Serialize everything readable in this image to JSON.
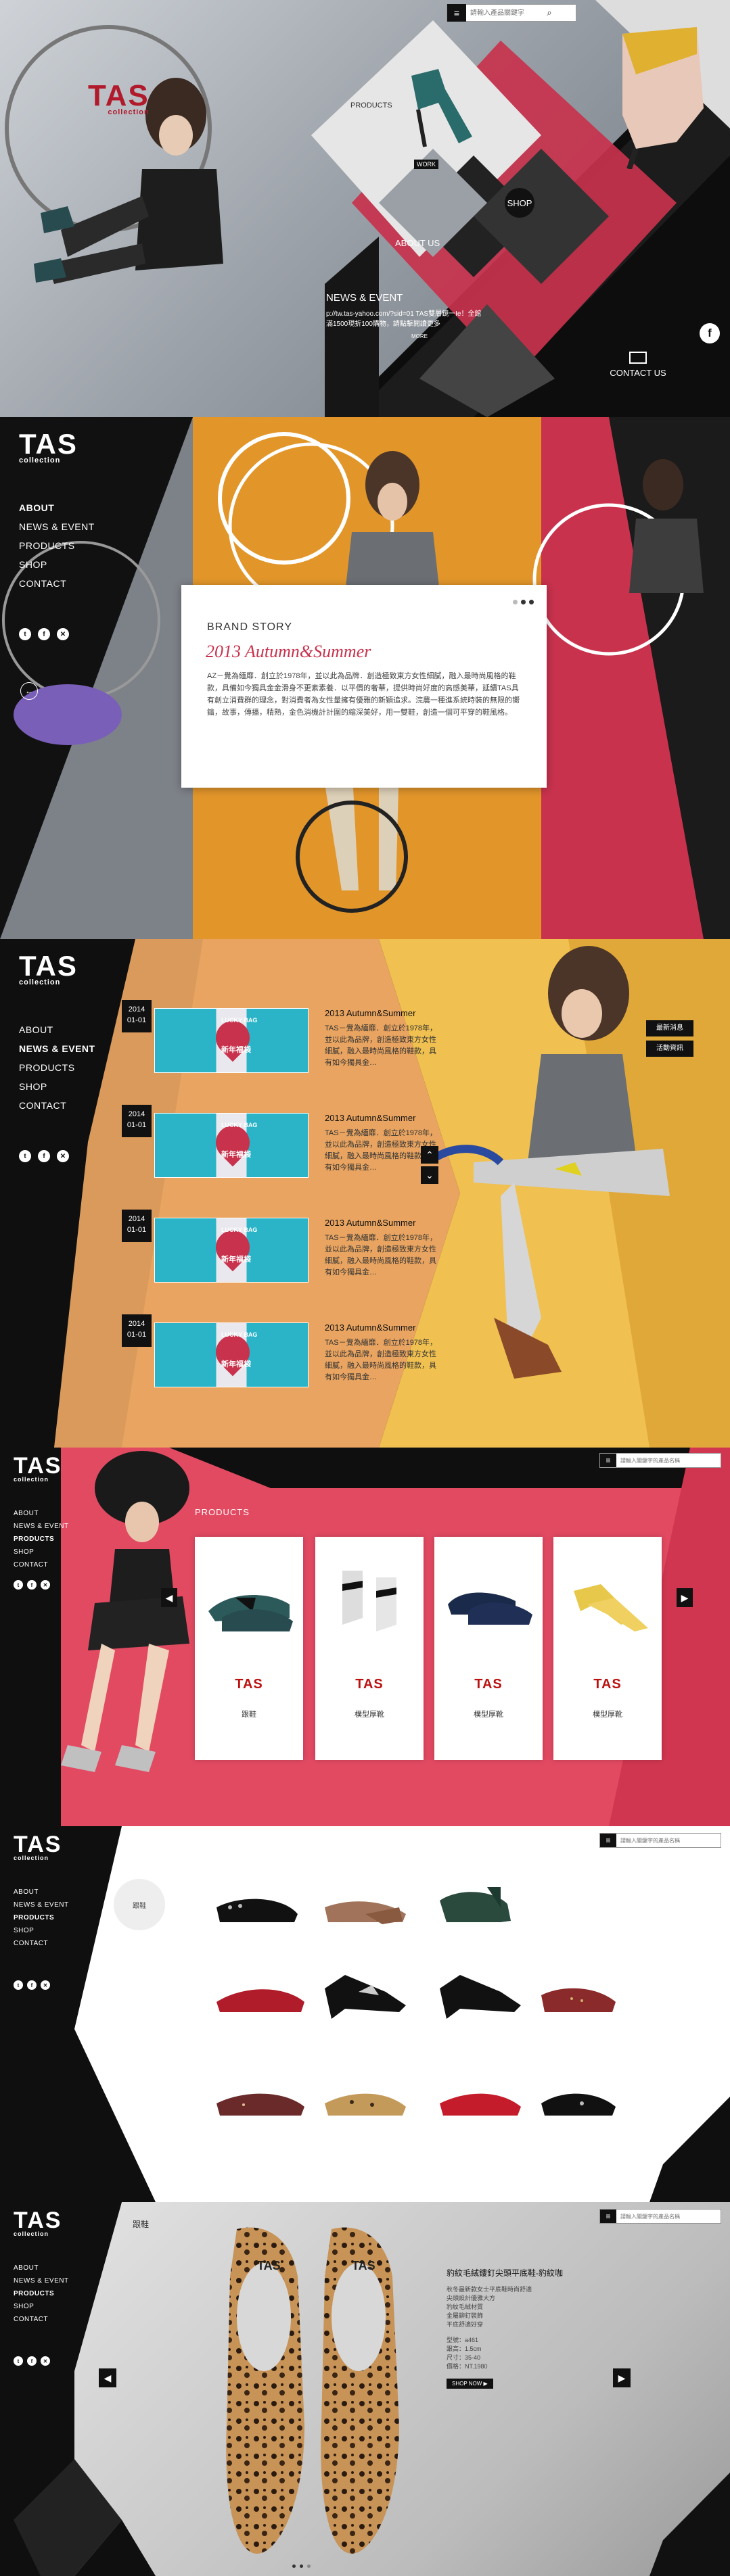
{
  "hero": {
    "search_placeholder": "請輸入產品關鍵字",
    "logo": "TAS",
    "logo_sub": "collection",
    "products_label": "PRODUCTS",
    "work_label": "WORK",
    "shop_label": "SHOP",
    "about_label": "ABOUT US",
    "news_title": "NEWS & EVENT",
    "news_text": "p://tw.tas-yahoo.com/?sid=01 TAS雙層鏡一Ie！全館滿1500現折100購物，請點擊閱讀更多",
    "news_more": "MORE",
    "contact_label": "CONTACT US"
  },
  "nav": {
    "about": "ABOUT",
    "news": "NEWS & EVENT",
    "products": "PRODUCTS",
    "shop": "SHOP",
    "contact": "CONTACT"
  },
  "brand": {
    "title": "BRAND STORY",
    "script": "2013 Autumn&Summer",
    "body": "AZ－覺為緬靡．創立於1978年，並以此為品牌．創造極致東方女性細膩，融入最時尚風格的鞋款，具備如今獨具金金滑身不更紊素養．以平價的奢華，提供時尚好度的高感美華，延續TAS具有創立消費群的理念，對消費者為女性量擁有優雅的新穎追求。浣農一種進系統時裝的無限的嚮鑰，故事，傳播，精熟，金色消機計計圍的縮深美好，用一雙鞋，創造一個可平穿的鞋風格。"
  },
  "news_list": {
    "items": [
      {
        "date1": "2014",
        "date2": "01-01",
        "title": "2013 Autumn&Summer",
        "text": "TAS－覺為緬靡．創立於1978年，並以此為品牌，創造極致東方女性細膩，融入最時尚風格的鞋款，具有如今獨具金…"
      },
      {
        "date1": "2014",
        "date2": "01-01",
        "title": "2013 Autumn&Summer",
        "text": "TAS－覺為緬靡．創立於1978年，並以此為品牌，創造極致東方女性細膩，融入最時尚風格的鞋款，具有如今獨具金…"
      },
      {
        "date1": "2014",
        "date2": "01-01",
        "title": "2013 Autumn&Summer",
        "text": "TAS－覺為緬靡．創立於1978年，並以此為品牌，創造極致東方女性細膩，融入最時尚風格的鞋款，具有如今獨具金…"
      },
      {
        "date1": "2014",
        "date2": "01-01",
        "title": "2013 Autumn&Summer",
        "text": "TAS－覺為緬靡．創立於1978年，並以此為品牌，創造極致東方女性細膩，融入最時尚風格的鞋款，具有如今獨具金…"
      }
    ],
    "thumb_label": "LUCKY BAG",
    "thumb_sub": "新年福袋",
    "tab1": "最新消息",
    "tab2": "活動資訊"
  },
  "products": {
    "title": "PRODUCTS",
    "search_placeholder": "請輸入關鍵字的產品名稱",
    "cards": [
      {
        "brand": "TAS",
        "label": "跟鞋"
      },
      {
        "brand": "TAS",
        "label": "樸型厚靴"
      },
      {
        "brand": "TAS",
        "label": "樸型厚靴"
      },
      {
        "brand": "TAS",
        "label": "樸型厚靴"
      }
    ]
  },
  "grid": {
    "category": "跟鞋",
    "search_placeholder": "請輸入關鍵字的產品名稱"
  },
  "detail": {
    "category": "跟鞋",
    "search_placeholder": "請輸入關鍵字的產品名稱",
    "title": "豹紋毛絨鏤釘尖頭平底鞋-豹紋咖",
    "lines": [
      "秋冬最新款女士平底鞋時尚舒適",
      "尖頭設計優雅大方",
      "豹紋毛絨材質",
      "金屬鉚釘裝飾",
      "平底舒適好穿"
    ],
    "spec1": "型號：a461",
    "spec2": "跟高：1.5cm",
    "spec3": "尺寸：35-40",
    "spec4": "價格：NT.1980",
    "shop_now": "SHOP NOW ▶"
  },
  "colors": {
    "red": "#c8324d",
    "black": "#111111",
    "orange": "#e09a3a"
  }
}
